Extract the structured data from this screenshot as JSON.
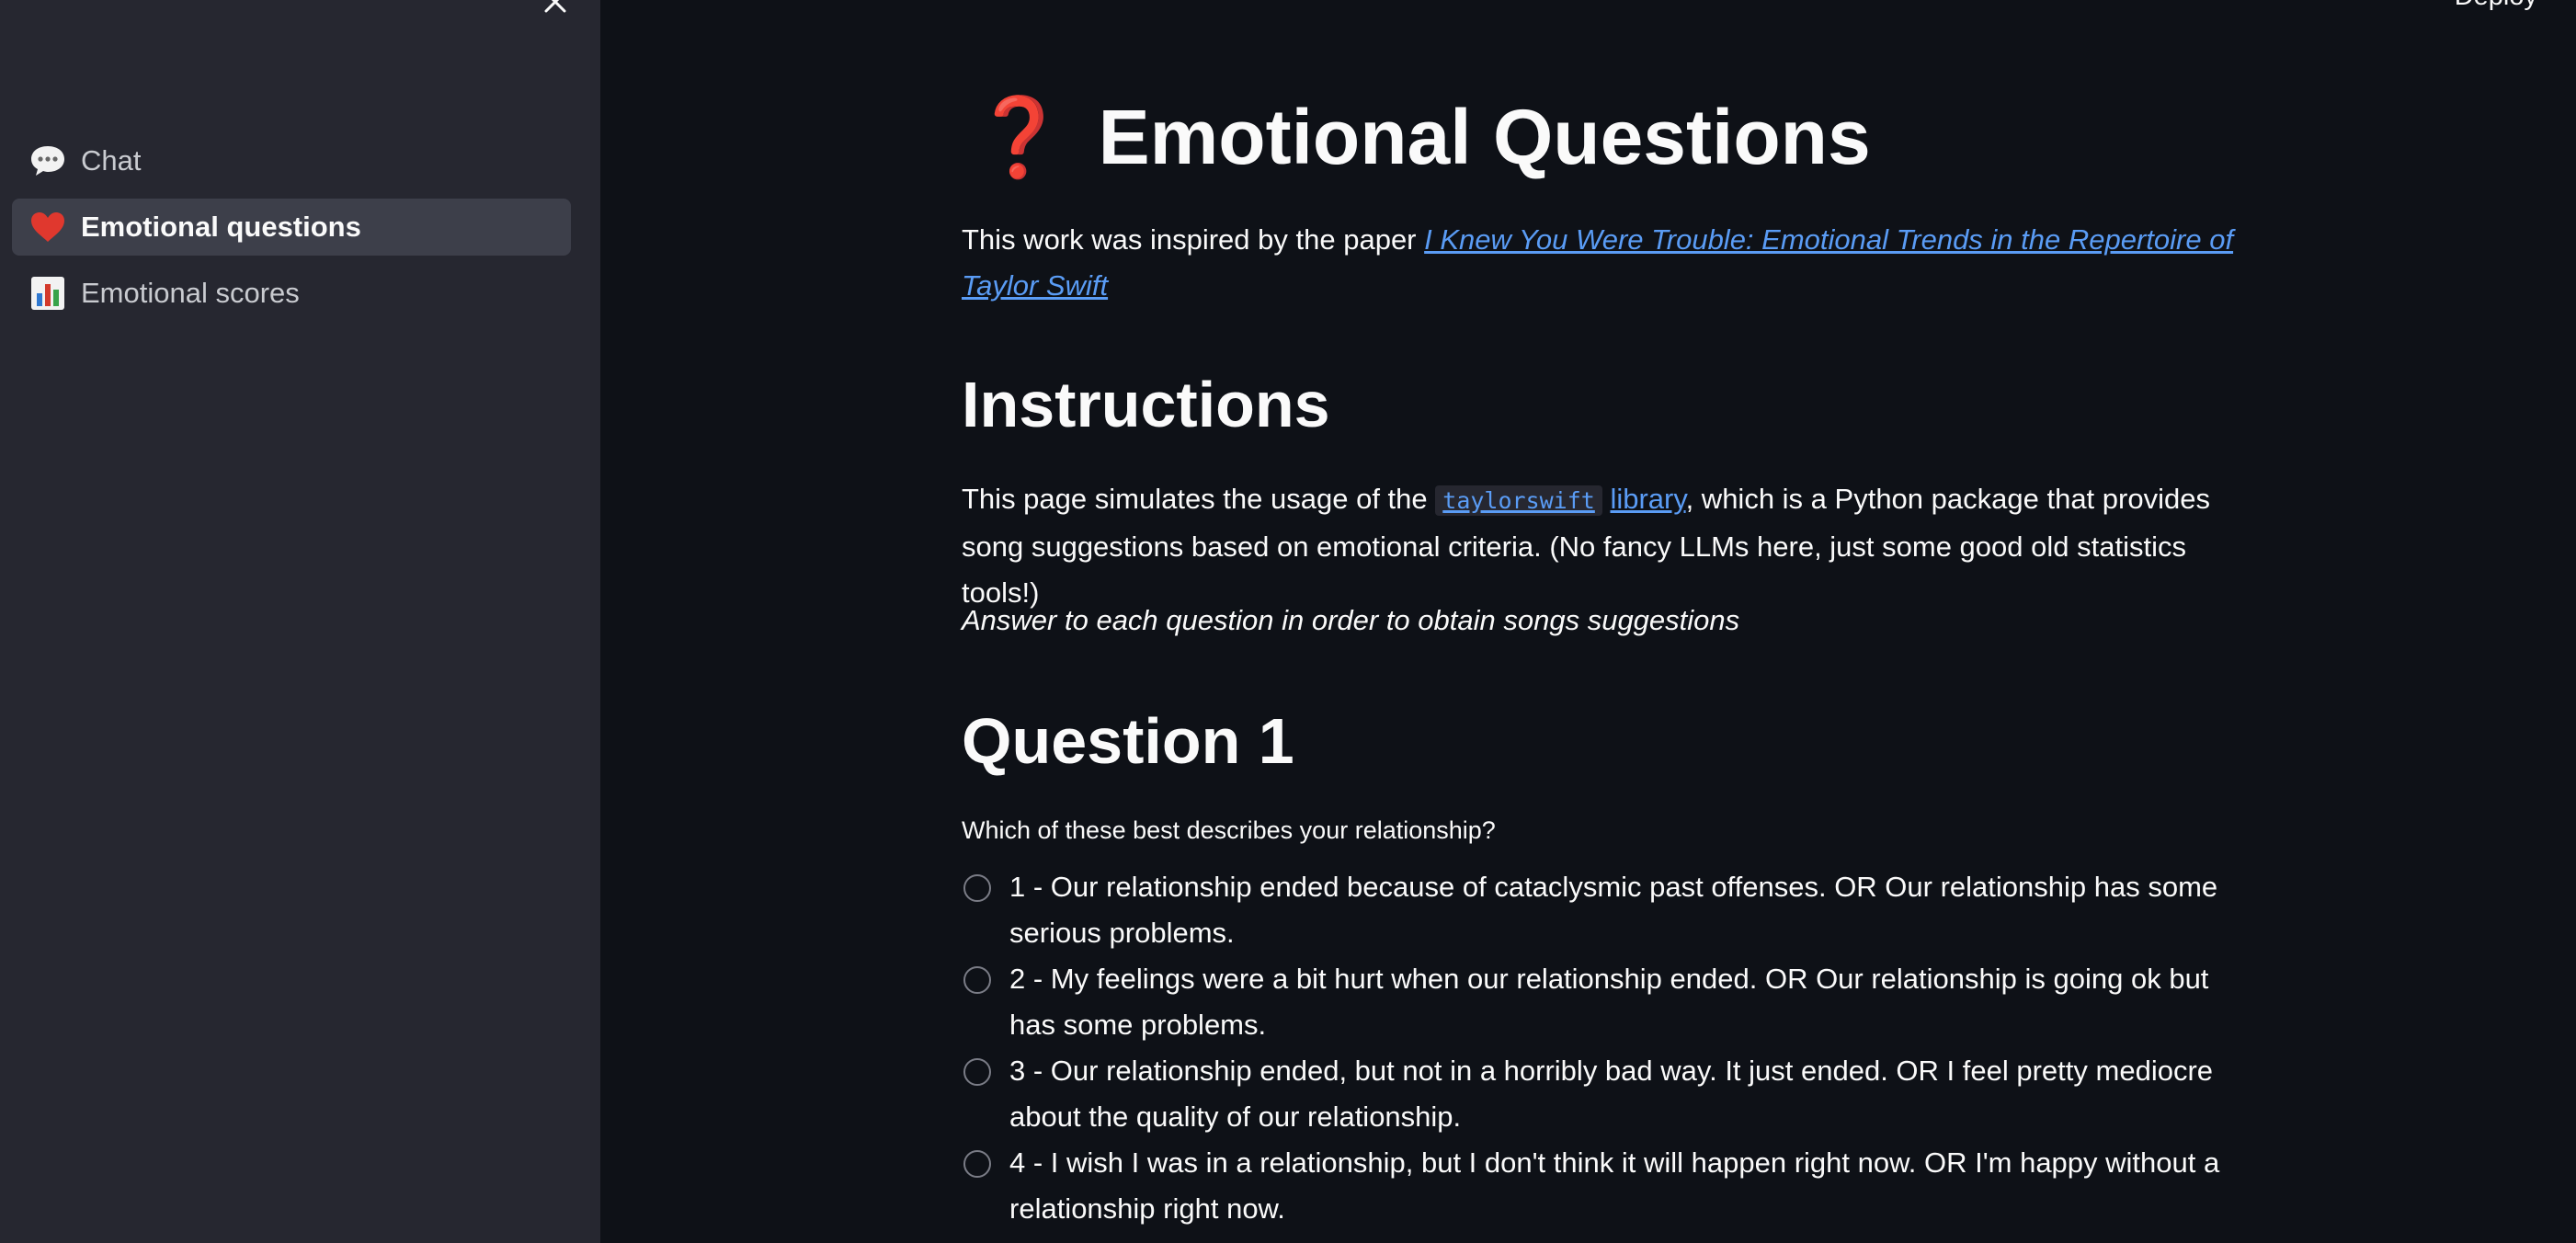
{
  "header": {
    "deploy_label": "Deploy"
  },
  "sidebar": {
    "items": [
      {
        "label": "Chat",
        "icon": "speech-bubble-icon",
        "active": false
      },
      {
        "label": "Emotional questions",
        "icon": "heart-icon",
        "active": true
      },
      {
        "label": "Emotional scores",
        "icon": "bar-chart-icon",
        "active": false
      }
    ]
  },
  "main": {
    "title": "Emotional Questions",
    "intro_prefix": "This work was inspired by the paper ",
    "intro_link": "I Knew You Were Trouble: Emotional Trends in the Repertoire of Taylor Swift",
    "instructions_heading": "Instructions",
    "instr_prefix": "This page simulates the usage of the ",
    "instr_code": "taylorswift",
    "instr_link": "library",
    "instr_suffix": ", which is a Python package that provides song suggestions based on emotional criteria. (No fancy LLMs here, just some good old statistics tools!)",
    "answer_note": "Answer to each question in order to obtain songs suggestions",
    "question_heading": "Question 1",
    "question_label": "Which of these best describes your relationship?",
    "options": [
      "1 - Our relationship ended because of cataclysmic past offenses. OR Our relationship has some serious problems.",
      "2 - My feelings were a bit hurt when our relationship ended. OR Our relationship is going ok but has some problems.",
      "3 - Our relationship ended, but not in a horribly bad way. It just ended. OR I feel pretty mediocre about the quality of our relationship.",
      "4 - I wish I was in a relationship, but I don't think it will happen right now. OR I'm happy without a relationship right now."
    ]
  },
  "colors": {
    "background": "#0e1117",
    "sidebar": "#262730",
    "link": "#5a9cf5",
    "accent_red": "#e0382e"
  }
}
